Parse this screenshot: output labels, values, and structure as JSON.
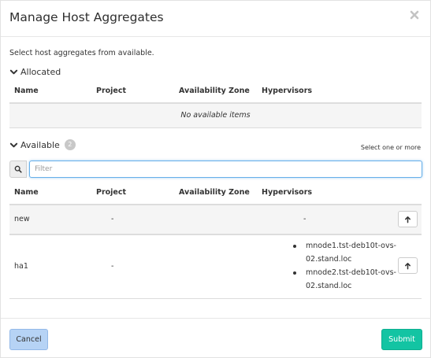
{
  "modal": {
    "title": "Manage Host Aggregates",
    "intro": "Select host aggregates from available."
  },
  "allocated": {
    "heading": "Allocated",
    "columns": [
      "Name",
      "Project",
      "Availability Zone",
      "Hypervisors"
    ],
    "empty_text": "No available items"
  },
  "available": {
    "heading": "Available",
    "count": "2",
    "select_hint": "Select one or more",
    "filter_placeholder": "Filter",
    "columns": [
      "Name",
      "Project",
      "Availability Zone",
      "Hypervisors"
    ],
    "rows": [
      {
        "name": "new",
        "project": "-",
        "hypervisors_text": "-"
      },
      {
        "name": "ha1",
        "project": "-",
        "hypervisors": [
          "mnode1.tst-deb10t-ovs-02.stand.loc",
          "mnode2.tst-deb10t-ovs-02.stand.loc"
        ]
      }
    ]
  },
  "footer": {
    "cancel_label": "Cancel",
    "submit_label": "Submit"
  },
  "colors": {
    "submit": "#13c4a3",
    "cancel": "#b6d3f5",
    "focus": "#66afe9"
  },
  "icons": {
    "close": "close-icon",
    "chevron": "chevron-down-icon",
    "search": "search-icon",
    "arrow_up": "arrow-up-icon"
  }
}
